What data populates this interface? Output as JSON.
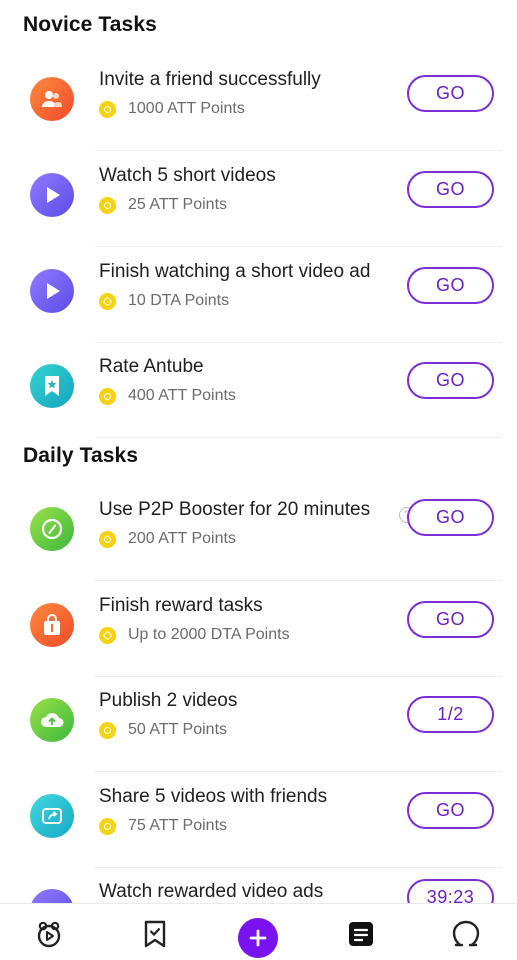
{
  "sections": {
    "novice": {
      "title": "Novice Tasks",
      "tasks": [
        {
          "title": "Invite a friend successfully",
          "reward": "1000 ATT Points",
          "button": "GO",
          "icon": "invite-friend-icon",
          "currency_icon": "att-coin-icon"
        },
        {
          "title": "Watch 5 short videos",
          "reward": "25 ATT Points",
          "button": "GO",
          "icon": "play-video-icon",
          "currency_icon": "att-coin-icon"
        },
        {
          "title": "Finish watching a short video ad",
          "reward": "10 DTA Points",
          "button": "GO",
          "icon": "play-ad-icon",
          "currency_icon": "dta-coin-icon"
        },
        {
          "title": "Rate Antube",
          "reward": "400 ATT Points",
          "button": "GO",
          "icon": "rate-bookmark-icon",
          "currency_icon": "att-coin-icon"
        }
      ]
    },
    "daily": {
      "title": "Daily Tasks",
      "tasks": [
        {
          "title": "Use P2P Booster for 20 minutes",
          "reward": "200 ATT Points",
          "button": "GO",
          "icon": "p2p-booster-icon",
          "currency_icon": "att-coin-icon",
          "help": "?"
        },
        {
          "title": "Finish reward tasks",
          "reward": "Up to 2000 DTA Points",
          "button": "GO",
          "icon": "reward-bag-icon",
          "currency_icon": "dta-coin-icon"
        },
        {
          "title": "Publish 2 videos",
          "reward": "50 ATT Points",
          "button": "1/2",
          "icon": "upload-cloud-icon",
          "currency_icon": "att-coin-icon"
        },
        {
          "title": "Share 5 videos with friends",
          "reward": "75 ATT Points",
          "button": "GO",
          "icon": "share-video-icon",
          "currency_icon": "att-coin-icon"
        },
        {
          "title": "Watch rewarded video ads",
          "reward": "",
          "button": "39:23",
          "icon": "play-rewarded-ad-icon",
          "currency_icon": ""
        }
      ]
    }
  },
  "bottom_nav": {
    "items": [
      "home-tab-icon",
      "bookmark-tab-icon",
      "add-icon",
      "tasks-tab-icon",
      "profile-tab-icon"
    ]
  },
  "colors": {
    "accent_purple": "#7a12f0",
    "button_border": "#7b2ed6",
    "coin_yellow": "#f7d20f"
  }
}
